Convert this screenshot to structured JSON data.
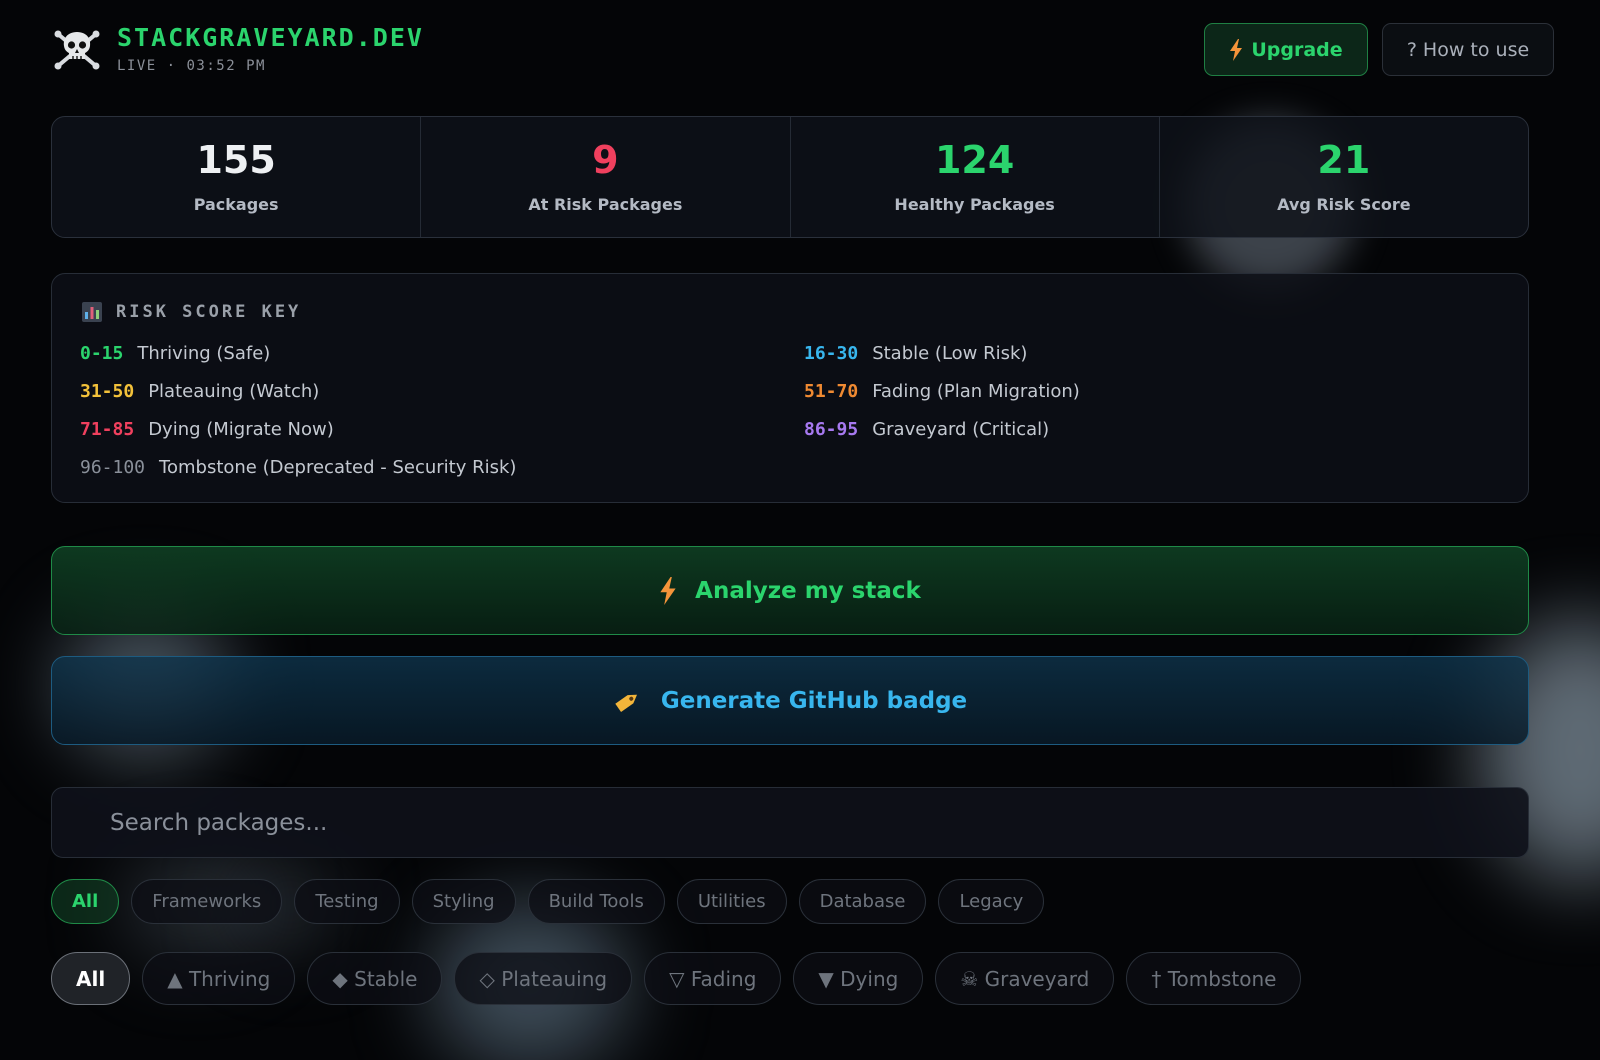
{
  "header": {
    "brand": "STACKGRAVEYARD.DEV",
    "status_line": "LIVE · 03:52 PM",
    "upgrade_label": "Upgrade",
    "help_label": "? How to use"
  },
  "stats": [
    {
      "value": "155",
      "label": "Packages",
      "color": "#eef0f3"
    },
    {
      "value": "9",
      "label": "At Risk Packages",
      "color": "#f0405e"
    },
    {
      "value": "124",
      "label": "Healthy Packages",
      "color": "#2bd46d"
    },
    {
      "value": "21",
      "label": "Avg Risk Score",
      "color": "#2bd46d"
    }
  ],
  "risk_key": {
    "title": "RISK SCORE KEY",
    "items": [
      {
        "range": "0-15",
        "label": "Thriving (Safe)",
        "color": "#2bd46d"
      },
      {
        "range": "16-30",
        "label": "Stable (Low Risk)",
        "color": "#38b6ee"
      },
      {
        "range": "31-50",
        "label": "Plateauing (Watch)",
        "color": "#f3c13a"
      },
      {
        "range": "51-70",
        "label": "Fading (Plan Migration)",
        "color": "#f08a32"
      },
      {
        "range": "71-85",
        "label": "Dying (Migrate Now)",
        "color": "#f0405e"
      },
      {
        "range": "86-95",
        "label": "Graveyard (Critical)",
        "color": "#a779f0"
      },
      {
        "range": "96-100",
        "label": "Tombstone (Deprecated - Security Risk)",
        "color": "#8a909a"
      }
    ]
  },
  "actions": {
    "analyze_label": "Analyze my stack",
    "badge_label": "Generate GitHub badge"
  },
  "search": {
    "placeholder": "Search packages...",
    "value": ""
  },
  "category_filters": [
    "All",
    "Frameworks",
    "Testing",
    "Styling",
    "Build Tools",
    "Utilities",
    "Database",
    "Legacy"
  ],
  "status_filters": [
    "All",
    "▲ Thriving",
    "◆ Stable",
    "◇ Plateauing",
    "▽ Fading",
    "▼ Dying",
    "☠ Graveyard",
    "† Tombstone"
  ],
  "colors": {
    "accent_green": "#2bd46d",
    "accent_blue": "#38b6ee",
    "accent_orange": "#f5943a"
  }
}
